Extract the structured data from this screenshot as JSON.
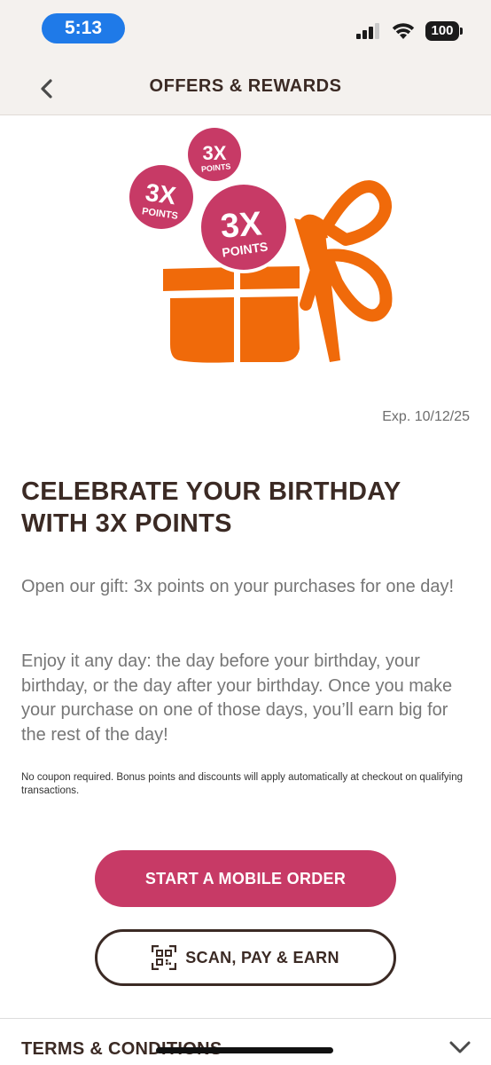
{
  "status_bar": {
    "time": "5:13",
    "battery": "100"
  },
  "header": {
    "title": "OFFERS & REWARDS"
  },
  "hero": {
    "badge_multiplier": "3X",
    "badge_points": "POINTS"
  },
  "offer": {
    "expiry": "Exp. 10/12/25",
    "headline": "CELEBRATE YOUR BIRTHDAY WITH 3X POINTS",
    "paragraph_1": "Open our gift: 3x points on your purchases for one day!",
    "paragraph_2": "Enjoy it any day: the day before your birthday, your birthday, or the day after your birthday. Once you make your purchase on one of those days, you’ll earn big for the rest of the day!",
    "fine_print": "No coupon required. Bonus points and discounts will apply automatically at checkout on qualifying transactions."
  },
  "actions": {
    "primary_label": "START A MOBILE ORDER",
    "secondary_label": "SCAN, PAY & EARN"
  },
  "terms": {
    "label": "TERMS & CONDITIONS"
  },
  "colors": {
    "accent_pink": "#c73a66",
    "gift_orange": "#f06a0a",
    "text_brown": "#3b2a24",
    "ios_blue": "#1f7ae8"
  },
  "icons": [
    "back-chevron-icon",
    "signal-icon",
    "wifi-icon",
    "battery-icon",
    "qr-code-icon",
    "chevron-down-icon"
  ]
}
